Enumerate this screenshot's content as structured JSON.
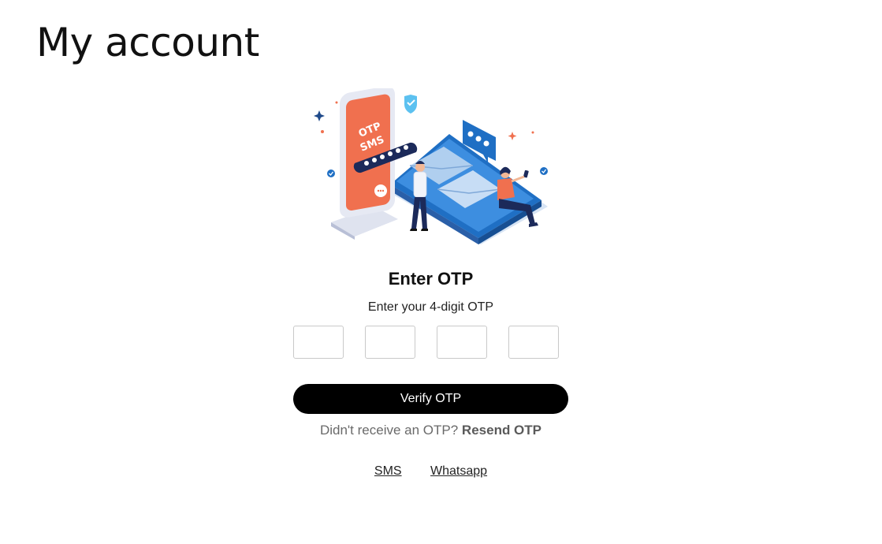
{
  "page": {
    "title": "My account"
  },
  "illustration": {
    "phone_text_line1": "OTP",
    "phone_text_line2": "SMS"
  },
  "otp": {
    "title": "Enter OTP",
    "subtitle": "Enter your 4-digit OTP",
    "digits": [
      "",
      "",
      "",
      ""
    ],
    "verify_label": "Verify OTP",
    "resend_prompt": "Didn't receive an OTP?",
    "resend_label": "Resend OTP"
  },
  "channels": {
    "sms_label": "SMS",
    "whatsapp_label": "Whatsapp"
  },
  "colors": {
    "accent_orange": "#f0704f",
    "accent_blue": "#1f6fc4",
    "dark_navy": "#1c2a5a",
    "button_bg": "#000000"
  }
}
